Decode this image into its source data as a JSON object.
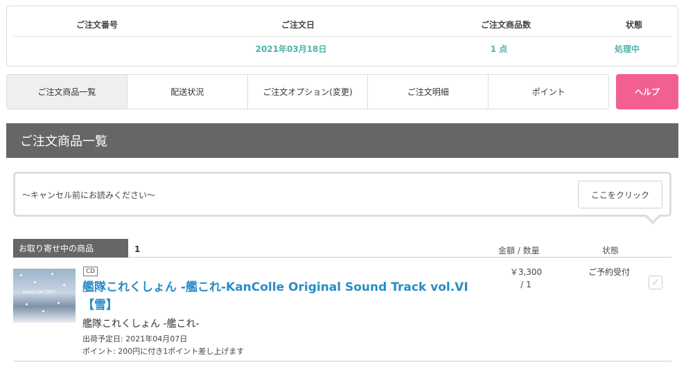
{
  "summary": {
    "headers": [
      "ご注文番号",
      "ご注文日",
      "ご注文商品数",
      "状態"
    ],
    "order_number": "",
    "order_date": "2021年03月18日",
    "item_count": "1 点",
    "status": "処理中",
    "value_color": "#4fb3a9"
  },
  "tabs": [
    {
      "label": "ご注文商品一覧",
      "active": true
    },
    {
      "label": "配送状況",
      "active": false
    },
    {
      "label": "ご注文オプション(変更)",
      "active": false
    },
    {
      "label": "ご注文明細",
      "active": false
    },
    {
      "label": "ポイント",
      "active": false
    }
  ],
  "help_label": "ヘルプ",
  "help_color": "#f2608f",
  "section_title": "ご注文商品一覧",
  "notice": {
    "text": "～キャンセル前にお読みください～",
    "button_label": "ここをクリック"
  },
  "items_header": {
    "label": "お取り寄せ中の商品",
    "count": "1",
    "price_qty_label": "金額 / 数量",
    "status_label": "状態"
  },
  "items": [
    {
      "media": "CD",
      "title": "艦隊これくしょん -艦これ-KanColle Original Sound Track vol.VI 【雪】",
      "artist": "艦隊これくしょん -艦これ-",
      "ship_date": "出荷予定日: 2021年04月07日",
      "points": "ポイント: 200円に付き1ポイント差し上げます",
      "price": "￥3,300",
      "quantity": "/ 1",
      "status": "ご予約受付",
      "thumb_logo": "KanColle OST",
      "check_icon": "check-icon"
    }
  ]
}
